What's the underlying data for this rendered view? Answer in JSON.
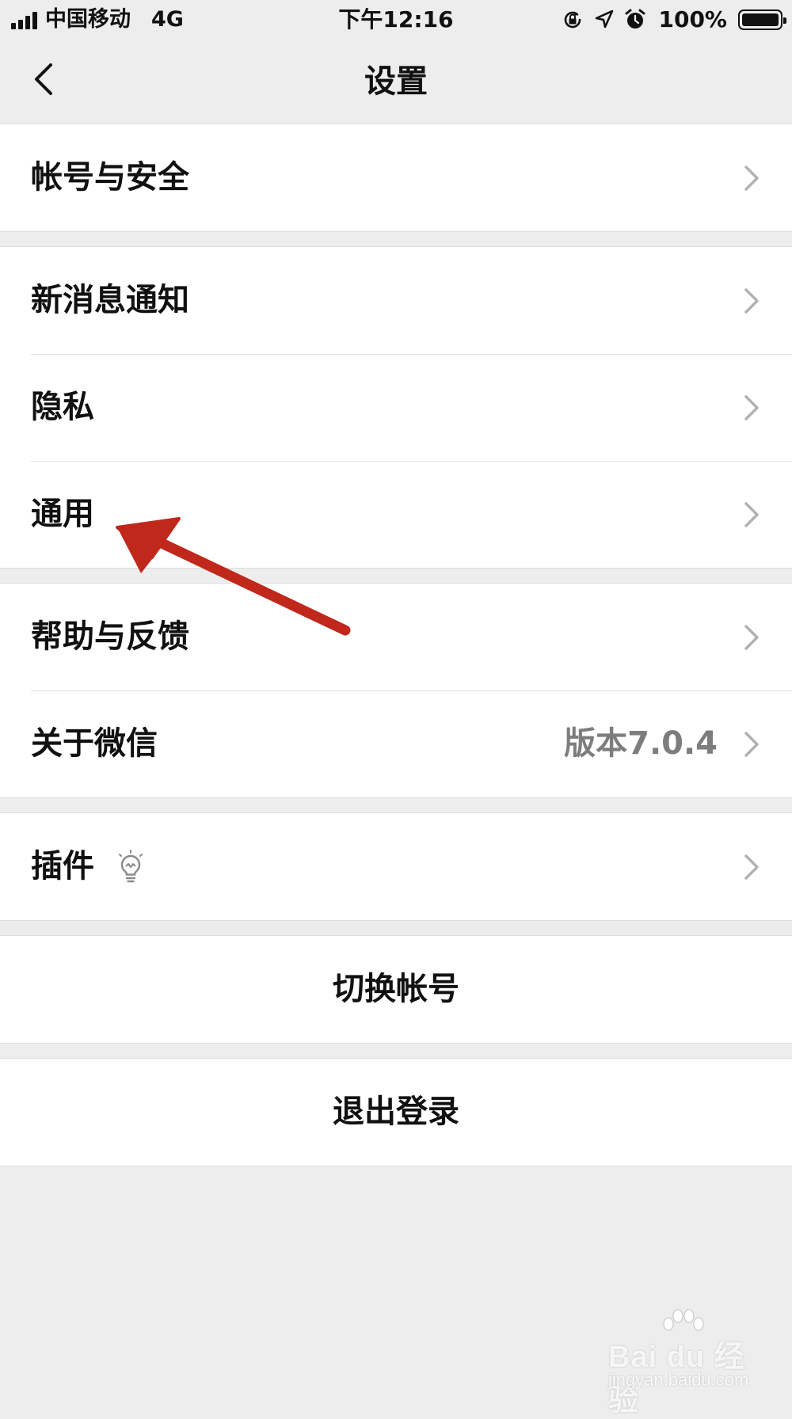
{
  "status_bar": {
    "carrier": "中国移动",
    "network": "4G",
    "time": "下午12:16",
    "battery": "100%",
    "battery_level": 1.0,
    "icons": [
      "signal-icon",
      "orientation-lock-icon",
      "location-icon",
      "alarm-icon",
      "battery-icon"
    ]
  },
  "nav": {
    "title": "设置",
    "back_icon": "chevron-left-icon"
  },
  "groups": [
    {
      "items": [
        {
          "label": "帐号与安全"
        }
      ]
    },
    {
      "items": [
        {
          "label": "新消息通知"
        },
        {
          "label": "隐私"
        },
        {
          "label": "通用"
        }
      ]
    },
    {
      "items": [
        {
          "label": "帮助与反馈"
        },
        {
          "label": "关于微信",
          "value": "版本7.0.4"
        }
      ]
    },
    {
      "items": [
        {
          "label": "插件",
          "icon": "lightbulb-icon"
        }
      ]
    }
  ],
  "actions": {
    "switch_account": "切换帐号",
    "logout": "退出登录"
  },
  "annotation": {
    "icon": "red-arrow-pointer",
    "color": "#c0281c",
    "points_to": "通用"
  },
  "watermark": {
    "brand": "Bai du 经验",
    "url": "jingyan.baidu.com"
  },
  "colors": {
    "background": "#ededed",
    "cell_background": "#ffffff",
    "secondary_text": "#7d7d7d",
    "chevron": "#b2b2b2"
  }
}
